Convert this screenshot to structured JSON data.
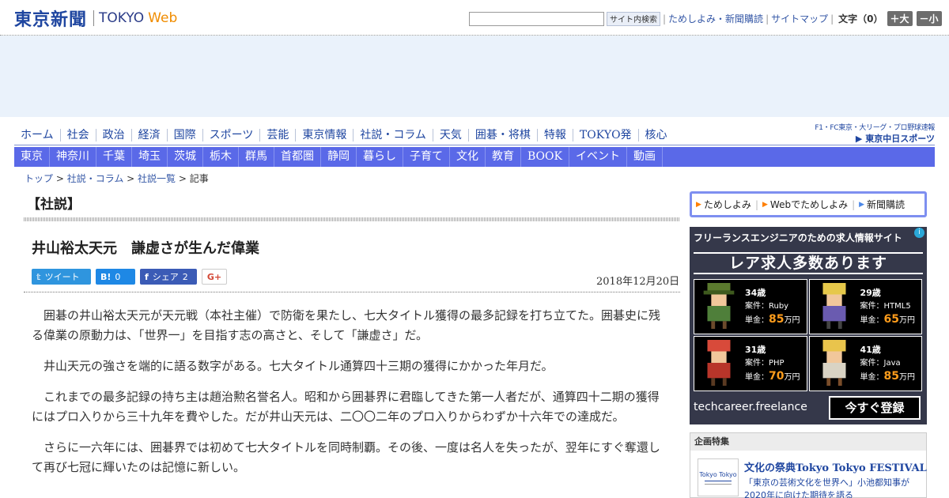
{
  "header": {
    "logo_jp": "東京新聞",
    "logo_tokyo": "TOKYO",
    "logo_web": "Web",
    "search_button": "サイト内検索",
    "links": [
      "ためしよみ・新聞購読",
      "サイトマップ"
    ],
    "font_size_label": "文字（0）",
    "font_larger": "＋大",
    "font_smaller": "－小"
  },
  "nav_main": [
    "ホーム",
    "社会",
    "政治",
    "経済",
    "国際",
    "スポーツ",
    "芸能",
    "東京情報",
    "社説・コラム",
    "天気",
    "囲碁・将棋",
    "特報",
    "TOKYO発",
    "核心"
  ],
  "chunichi": {
    "line1": "F1・FC東京・大リーグ・プロ野球速報",
    "line2": "▶ 東京中日スポーツ"
  },
  "nav_regions": [
    "東京",
    "神奈川",
    "千葉",
    "埼玉",
    "茨城",
    "栃木",
    "群馬",
    "首都圏",
    "静岡",
    "暮らし",
    "子育て",
    "文化",
    "教育",
    "BOOK",
    "イベント",
    "動画"
  ],
  "breadcrumb": [
    "トップ",
    "社説・コラム",
    "社説一覧",
    "記事"
  ],
  "section_title": "【社説】",
  "article": {
    "title": "井山裕太天元　謙虚さが生んだ偉業",
    "date": "2018年12月20日",
    "share": {
      "tweet": "ツイート",
      "hatena_count": "0",
      "facebook_label": "シェア",
      "facebook_count": "2",
      "gplus": "G+"
    },
    "paragraphs": [
      "囲碁の井山裕太天元が天元戦（本社主催）で防衛を果たし、七大タイトル獲得の最多記録を打ち立てた。囲碁史に残る偉業の原動力は、「世界一」を目指す志の高さと、そして「謙虚さ」だ。",
      "井山天元の強さを端的に語る数字がある。七大タイトル通算四十三期の獲得にかかった年月だ。",
      "これまでの最多記録の持ち主は趙治勲名誉名人。昭和から囲碁界に君臨してきた第一人者だが、通算四十二期の獲得にはプロ入りから三十九年を費やした。だが井山天元は、二〇〇二年のプロ入りからわずか十六年での達成だ。",
      "さらに一六年には、囲碁界では初めて七大タイトルを同時制覇。その後、一度は名人を失ったが、翌年にすぐ奪還して再び七冠に輝いたのは記憶に新しい。"
    ]
  },
  "sidebar": {
    "links": [
      "ためしよみ",
      "Webでためしよみ",
      "新聞購読"
    ],
    "ad": {
      "headline": "フリーランスエンジニアのための求人情報サイト",
      "banner": "レア求人多数あります",
      "cards": [
        {
          "age": "34歳",
          "case": "案件：Ruby",
          "pay_label": "単金：",
          "pay": "85",
          "unit": "万円"
        },
        {
          "age": "29歳",
          "case": "案件：HTML5",
          "pay_label": "単金：",
          "pay": "65",
          "unit": "万円"
        },
        {
          "age": "31歳",
          "case": "案件：PHP",
          "pay_label": "単金：",
          "pay": "70",
          "unit": "万円"
        },
        {
          "age": "41歳",
          "case": "案件：Java",
          "pay_label": "単金：",
          "pay": "85",
          "unit": "万円"
        }
      ],
      "footer": "techcareer.freelance",
      "cta": "今すぐ登録"
    },
    "feature": {
      "heading": "企画特集",
      "thumb_text": "Tokyo Tokyo",
      "title": "文化の祭典Tokyo Tokyo FESTIVAL",
      "text": "「東京の芸術文化を世界へ」小池都知事が2020年に向けた期待を語る"
    }
  },
  "colors": {
    "brand_blue": "#1f46a0",
    "nav_bar": "#5a69e8",
    "web_orange": "#f08c00",
    "ad_bg": "#35384a"
  }
}
